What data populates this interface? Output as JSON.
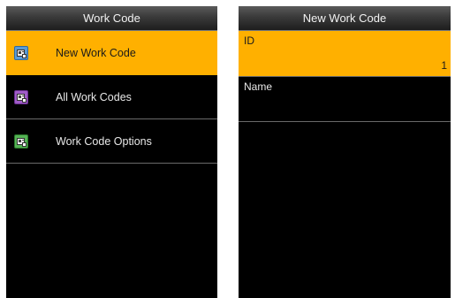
{
  "left_screen": {
    "title": "Work Code",
    "items": [
      {
        "label": "New Work Code",
        "icon": "new-work-code-icon",
        "icon_color": "#5b9bd5",
        "selected": true
      },
      {
        "label": "All Work Codes",
        "icon": "all-work-codes-icon",
        "icon_color": "#a05cc8",
        "selected": false
      },
      {
        "label": "Work Code Options",
        "icon": "work-code-options-icon",
        "icon_color": "#55b255",
        "selected": false
      }
    ]
  },
  "right_screen": {
    "title": "New Work Code",
    "fields": [
      {
        "label": "ID",
        "value": "1",
        "selected": true
      },
      {
        "label": "Name",
        "value": "",
        "selected": false
      }
    ]
  },
  "colors": {
    "highlight": "#ffb000",
    "background": "#000000",
    "title_text": "#f2f2f2",
    "item_text": "#e8e8e8",
    "divider": "#6a6a6a"
  }
}
